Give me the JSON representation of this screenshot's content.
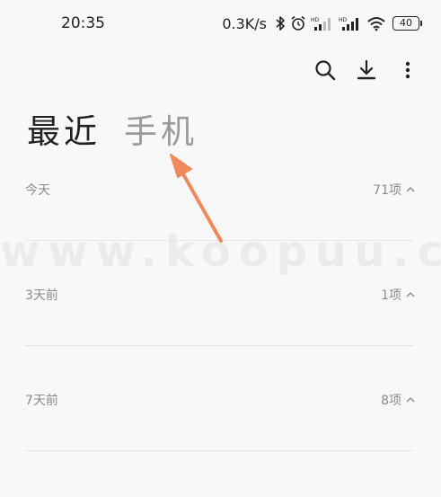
{
  "status_bar": {
    "time": "20:35",
    "net_speed": "0.3K/s",
    "icons": [
      "bluetooth-icon",
      "alarm-icon",
      "hd-signal-icon",
      "hd-signal-icon",
      "wifi-icon"
    ],
    "battery": "40"
  },
  "toolbar": {
    "icons": [
      "search-icon",
      "download-icon",
      "more-vertical-icon"
    ]
  },
  "tabs": [
    {
      "label": "最近",
      "active": true
    },
    {
      "label": "手机",
      "active": false
    }
  ],
  "sections": [
    {
      "title": "今天",
      "count": "71项"
    },
    {
      "title": "3天前",
      "count": "1项"
    },
    {
      "title": "7天前",
      "count": "8项"
    }
  ],
  "watermark": "www.koopuu.com",
  "colors": {
    "background": "#f8f8f8",
    "text_primary": "#222222",
    "text_secondary": "#8a8a8a",
    "tab_inactive": "#9a9a9a",
    "annotation_arrow": "#f08a5d"
  }
}
